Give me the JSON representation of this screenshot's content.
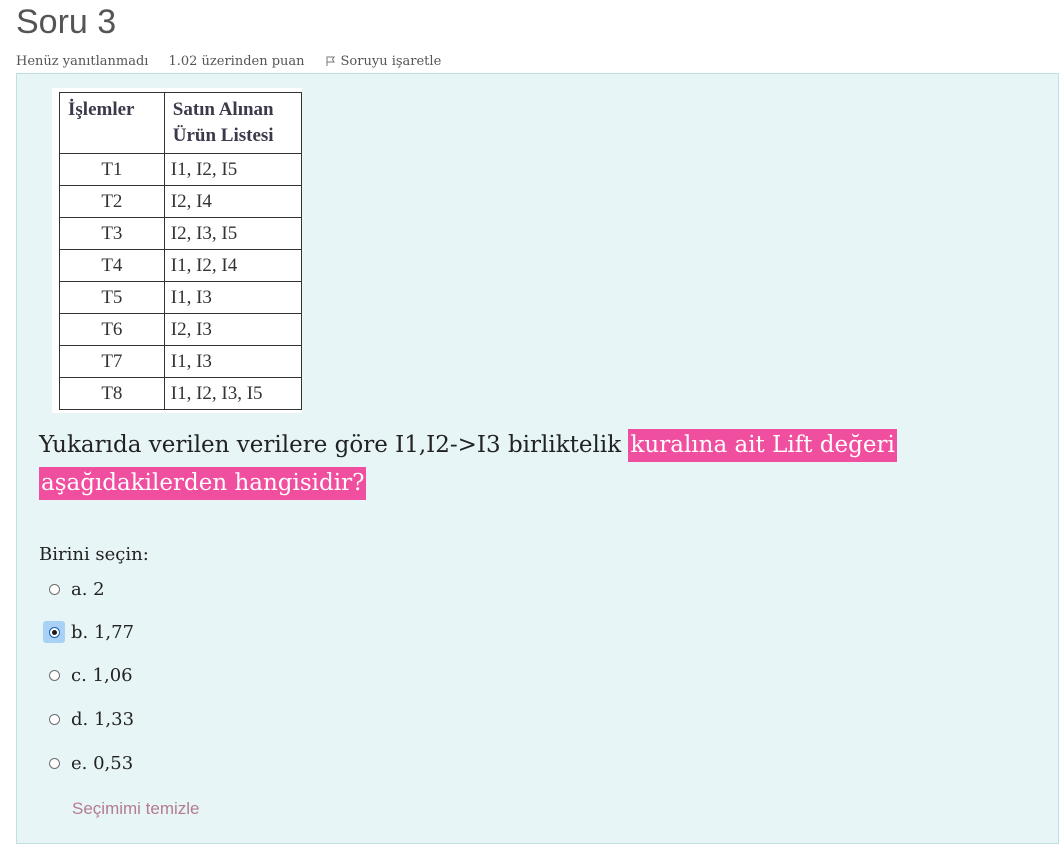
{
  "question": {
    "title": "Soru 3",
    "status": "Henüz yanıtlanmadı",
    "points": "1.02 üzerinden puan",
    "flag_label": "Soruyu işaretle"
  },
  "table": {
    "headers": [
      "İşlemler",
      "Satın Alınan Ürün Listesi"
    ],
    "rows": [
      [
        "T1",
        "I1, I2, I5"
      ],
      [
        "T2",
        "I2, I4"
      ],
      [
        "T3",
        "I2, I3, I5"
      ],
      [
        "T4",
        "I1, I2, I4"
      ],
      [
        "T5",
        "I1, I3"
      ],
      [
        "T6",
        "I2, I3"
      ],
      [
        "T7",
        "I1, I3"
      ],
      [
        "T8",
        "I1, I2, I3, I5"
      ]
    ]
  },
  "question_text": {
    "plain": "Yukarıda verilen verilere göre I1,I2->I3 birliktelik ",
    "highlight_1": "kuralına ait Lift değeri ",
    "highlight_2": "aşağıdakilerden hangisidir?"
  },
  "prompt": "Birini seçin:",
  "answers": [
    {
      "label": "a. 2",
      "selected": false
    },
    {
      "label": "b. 1,77",
      "selected": true
    },
    {
      "label": "c. 1,06",
      "selected": false
    },
    {
      "label": "d. 1,33",
      "selected": false
    },
    {
      "label": "e. 0,53",
      "selected": false
    }
  ],
  "clear_choice": "Seçimimi temizle",
  "colors": {
    "highlight": "#f04e9e",
    "panel_bg": "#e7f5f6",
    "link": "#b57b92"
  }
}
